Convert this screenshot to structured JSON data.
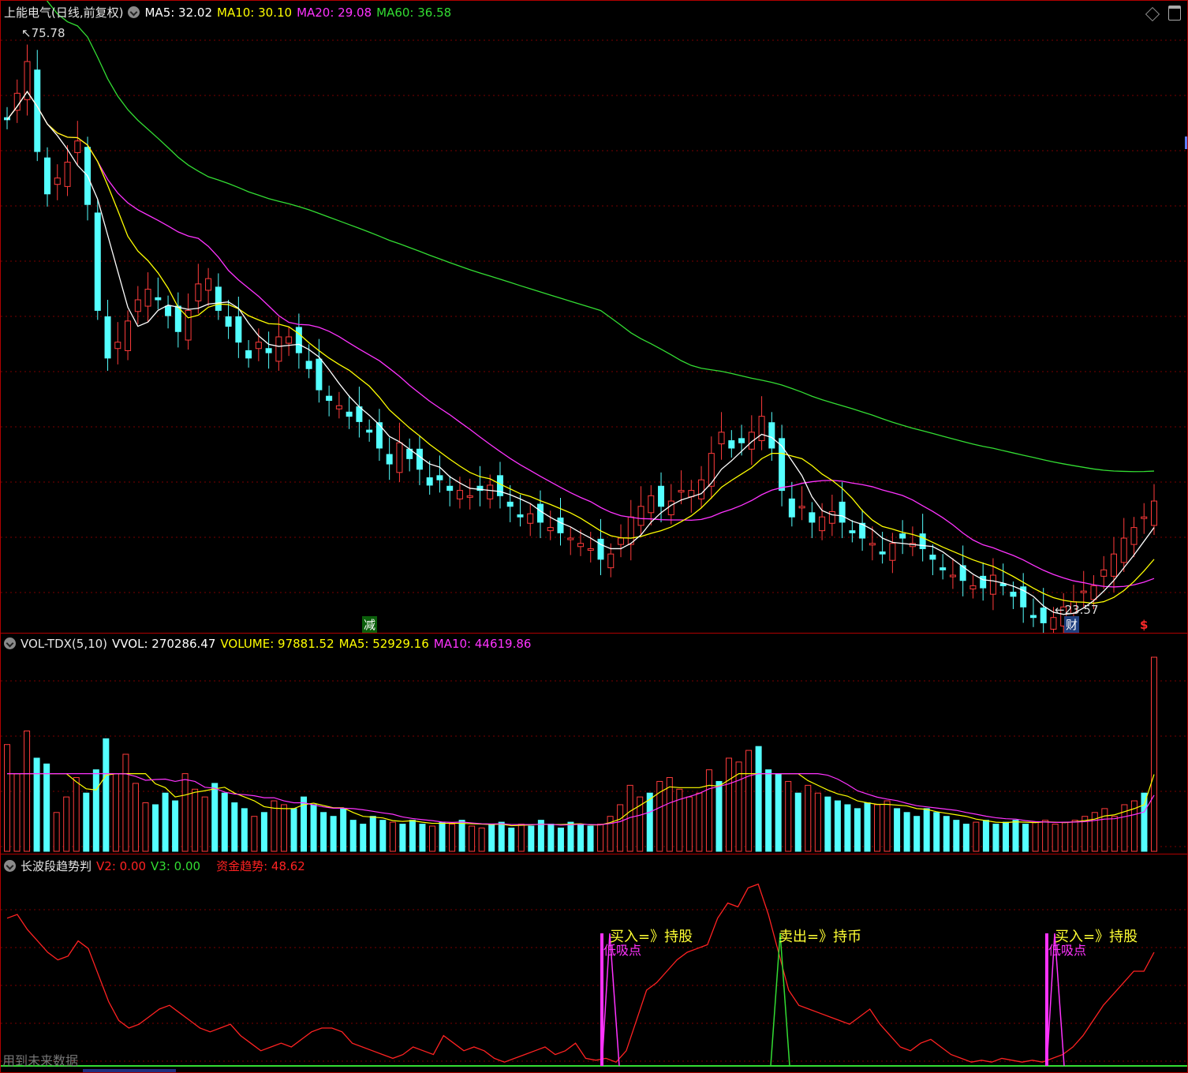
{
  "price_panel": {
    "title": "上能电气(日线,前复权)",
    "indicators": [
      {
        "label": "MA5: 32.02",
        "color": "#ffffff"
      },
      {
        "label": "MA10: 30.10",
        "color": "#ffff00"
      },
      {
        "label": "MA20: 29.08",
        "color": "#ff33ff"
      },
      {
        "label": "MA60: 36.58",
        "color": "#33dd33"
      }
    ],
    "high_label": "75.78",
    "low_label": "23.57",
    "tags": {
      "jian": "减",
      "cai": "财",
      "s": "$"
    }
  },
  "volume_panel": {
    "title": "VOL-TDX(5,10)",
    "indicators": [
      {
        "label": "VVOL: 270286.47",
        "color": "#ffffff"
      },
      {
        "label": "VOLUME: 97881.52",
        "color": "#ffff00"
      },
      {
        "label": "MA5: 52929.16",
        "color": "#ffff00"
      },
      {
        "label": "MA10: 44619.86",
        "color": "#ff33ff"
      }
    ]
  },
  "indicator_panel": {
    "title": "长波段趋势判",
    "indicators": [
      {
        "label": "V2: 0.00",
        "color": "#ff2222"
      },
      {
        "label": "V3: 0.00",
        "color": "#33dd33"
      },
      {
        "label": "资金趋势: 48.62",
        "color": "#ff2222"
      }
    ],
    "signals": {
      "buy1": "买入=》持股",
      "buy1_sub": "低吸点",
      "sell1": "卖出=》持币",
      "buy2": "买入=》持股",
      "buy2_sub": "低吸点"
    },
    "footer_note": "用到未来数据"
  },
  "colors": {
    "up": "#ff3b3b",
    "down": "#54ffff",
    "ma5": "#ffffff",
    "ma10": "#ffff00",
    "ma20": "#ff33ff",
    "ma60": "#33dd33",
    "grid": "#7a0000",
    "trend": "#ff2222",
    "buy_bar": "#ff33ff",
    "sell_bar": "#33dd33"
  },
  "chart_data": [
    {
      "type": "candlestick",
      "title": "上能电气(日线,前复权)",
      "price_extremes": {
        "high": 75.78,
        "low": 23.57
      },
      "ma_last": {
        "MA5": 32.02,
        "MA10": 30.1,
        "MA20": 29.08,
        "MA60": 36.58
      },
      "close_path": [
        68.0,
        70.5,
        73.5,
        65.0,
        61.0,
        62.5,
        64.0,
        66.0,
        60.0,
        50.0,
        45.5,
        47.0,
        49.0,
        51.0,
        52.0,
        51.0,
        49.5,
        48.0,
        50.0,
        52.5,
        53.0,
        50.0,
        48.5,
        47.0,
        45.5,
        47.0,
        46.0,
        47.5,
        47.5,
        46.0,
        44.5,
        42.5,
        41.5,
        41.0,
        40.0,
        39.5,
        38.5,
        37.0,
        35.5,
        37.5,
        36.0,
        35.0,
        33.5,
        34.0,
        33.0,
        33.0,
        32.5,
        33.0,
        33.5,
        32.5,
        31.5,
        30.5,
        30.8,
        30.0,
        29.5,
        29.0,
        28.5,
        28.0,
        27.5,
        26.5,
        27.0,
        28.5,
        30.5,
        31.5,
        32.5,
        31.5,
        32.0,
        33.0,
        33.0,
        34.0,
        36.5,
        38.5,
        37.0,
        37.5,
        38.5,
        40.0,
        37.0,
        33.0,
        30.5,
        31.5,
        30.0,
        30.5,
        31.0,
        30.0,
        29.0,
        28.5,
        28.0,
        27.0,
        28.0,
        28.5,
        28.0,
        27.5,
        26.5,
        25.5,
        25.0,
        24.5,
        24.0,
        23.8,
        25.0,
        24.0,
        23.0,
        22.0,
        21.0,
        20.5,
        21.0,
        22.0,
        22.5,
        23.5,
        24.0,
        25.5,
        27.0,
        28.5,
        29.5,
        30.5,
        32.0
      ]
    },
    {
      "type": "bar",
      "title": "VOL-TDX(5,10)",
      "last_values": {
        "VVOL": 270286.47,
        "VOLUME": 97881.52,
        "MA5": 52929.16,
        "MA10": 44619.86
      },
      "volume_path": [
        55,
        40,
        62,
        48,
        45,
        20,
        28,
        38,
        30,
        42,
        58,
        40,
        50,
        35,
        25,
        24,
        30,
        26,
        40,
        32,
        28,
        35,
        30,
        25,
        22,
        18,
        20,
        26,
        24,
        22,
        28,
        24,
        20,
        18,
        22,
        16,
        14,
        18,
        16,
        15,
        14,
        16,
        14,
        13,
        15,
        14,
        16,
        13,
        12,
        14,
        15,
        12,
        14,
        13,
        16,
        14,
        12,
        15,
        14,
        13,
        14,
        18,
        24,
        34,
        28,
        30,
        36,
        38,
        32,
        28,
        30,
        42,
        36,
        48,
        46,
        52,
        54,
        42,
        40,
        36,
        30,
        34,
        30,
        28,
        26,
        24,
        22,
        25,
        24,
        26,
        22,
        20,
        18,
        22,
        20,
        18,
        16,
        14,
        15,
        16,
        14,
        15,
        16,
        14,
        15,
        16,
        14,
        15,
        16,
        18,
        20,
        22,
        18,
        24,
        26,
        30,
        100
      ]
    },
    {
      "type": "line",
      "title": "长波段趋势判",
      "last_values": {
        "V2": 0.0,
        "V3": 0.0,
        "资金趋势": 48.62
      },
      "trend_path": [
        78,
        80,
        72,
        66,
        60,
        56,
        58,
        66,
        62,
        48,
        34,
        24,
        20,
        22,
        26,
        30,
        32,
        28,
        24,
        20,
        18,
        20,
        22,
        16,
        12,
        8,
        10,
        12,
        10,
        14,
        18,
        20,
        20,
        18,
        12,
        10,
        8,
        6,
        4,
        6,
        10,
        8,
        6,
        16,
        12,
        8,
        10,
        8,
        4,
        2,
        4,
        6,
        8,
        10,
        6,
        8,
        12,
        4,
        3,
        4,
        2,
        8,
        24,
        40,
        44,
        50,
        56,
        60,
        62,
        64,
        78,
        86,
        84,
        94,
        96,
        80,
        60,
        40,
        32,
        30,
        28,
        26,
        24,
        22,
        26,
        30,
        22,
        16,
        10,
        8,
        12,
        14,
        10,
        6,
        4,
        2,
        3,
        2,
        4,
        3,
        2,
        3,
        2,
        4,
        6,
        10,
        16,
        24,
        32,
        38,
        44,
        50,
        50,
        60
      ],
      "signal_labels": [
        "买入=》持股",
        "卖出=》持币",
        "买入=》持股"
      ]
    }
  ]
}
